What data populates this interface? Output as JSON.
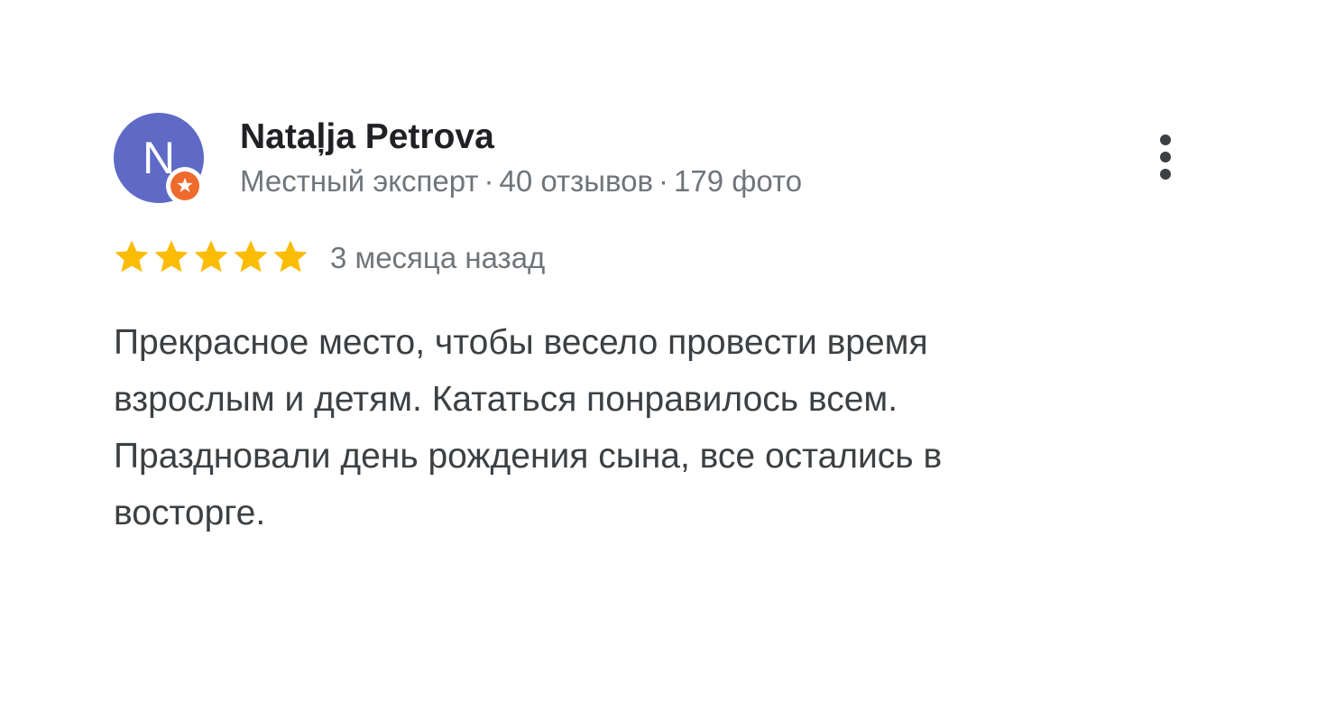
{
  "reviewer": {
    "initial": "N",
    "name": "Nataļja Petrova",
    "badge": "Местный эксперт",
    "separator": "·",
    "reviews": "40 отзывов",
    "photos": "179 фото",
    "avatar_color": "#5e6ac6",
    "badge_color": "#ee6b2d",
    "badge_icon": "local-guide-star-icon"
  },
  "menu": {
    "icon": "more-vertical-icon"
  },
  "rating": {
    "value": 5,
    "max": 5,
    "star_color": "#fbbc04"
  },
  "review": {
    "date": "3 месяца назад",
    "lines": [
      "Прекрасное место, чтобы весело провести время",
      "взрослым и детям. Кататься понравилось всем.",
      "Праздновали день рождения сына, все остались в",
      "восторге."
    ]
  }
}
